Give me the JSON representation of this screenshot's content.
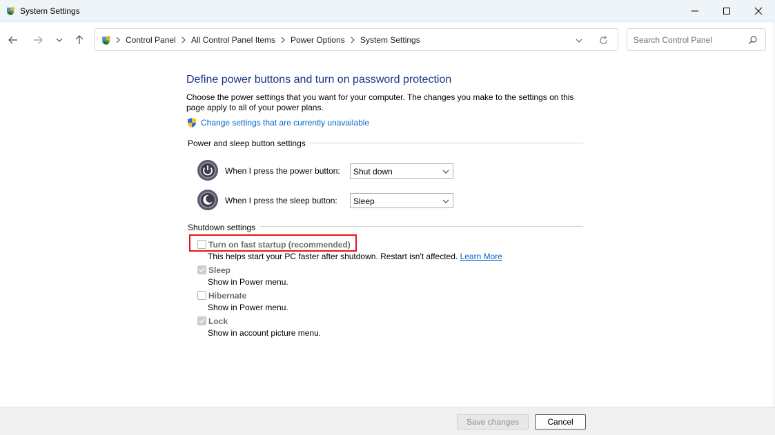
{
  "window": {
    "title": "System Settings",
    "controls": [
      "minimize-icon",
      "maximize-icon",
      "close-icon"
    ]
  },
  "nav": {
    "breadcrumbs": [
      "Control Panel",
      "All Control Panel Items",
      "Power Options",
      "System Settings"
    ],
    "search_placeholder": "Search Control Panel"
  },
  "main": {
    "heading": "Define power buttons and turn on password protection",
    "description": "Choose the power settings that you want for your computer. The changes you make to the settings on this page apply to all of your power plans.",
    "change_link": "Change settings that are currently unavailable",
    "power_section": {
      "label": "Power and sleep button settings",
      "power_button_label": "When I press the power button:",
      "power_button_value": "Shut down",
      "sleep_button_label": "When I press the sleep button:",
      "sleep_button_value": "Sleep"
    },
    "shutdown_section": {
      "label": "Shutdown settings",
      "items": [
        {
          "label": "Turn on fast startup (recommended)",
          "checked": false,
          "desc": "This helps start your PC faster after shutdown. Restart isn't affected.",
          "link": "Learn More"
        },
        {
          "label": "Sleep",
          "checked": true,
          "desc": "Show in Power menu."
        },
        {
          "label": "Hibernate",
          "checked": false,
          "desc": "Show in Power menu."
        },
        {
          "label": "Lock",
          "checked": true,
          "desc": "Show in account picture menu."
        }
      ]
    }
  },
  "footer": {
    "save_label": "Save changes",
    "cancel_label": "Cancel"
  },
  "colors": {
    "heading": "#1e3287",
    "link": "#0066cc",
    "highlight": "#e3141a"
  }
}
